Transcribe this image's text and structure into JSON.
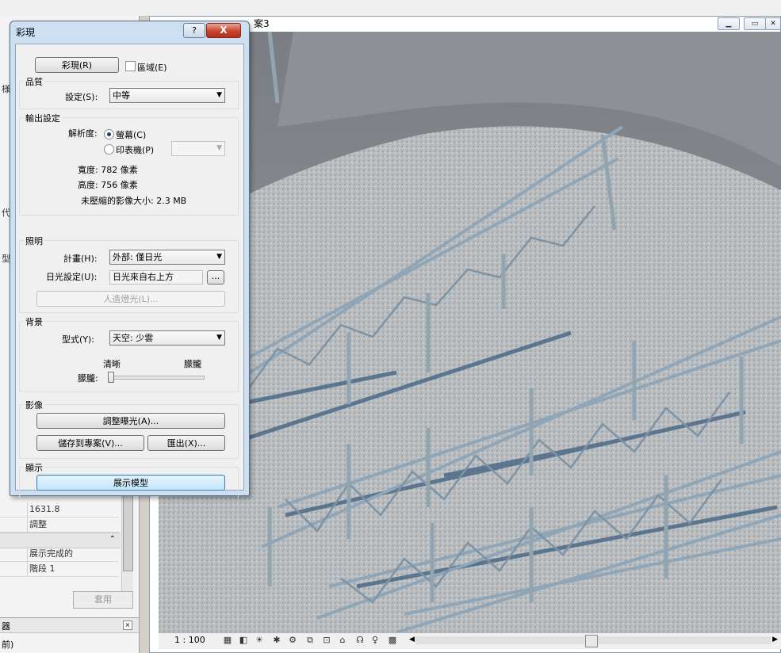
{
  "view": {
    "title_fragment": "案3",
    "scale": "1 : 100",
    "window_controls": [
      "min-icon",
      "restore-icon",
      "close-icon"
    ]
  },
  "left_panel": {
    "glyph_1": "様",
    "glyph_2": "代",
    "glyph_3": "型表",
    "props": [
      {
        "value": "1631.8"
      },
      {
        "value": "調整"
      },
      {
        "value": "展示完成的"
      },
      {
        "value": "階段 1"
      }
    ],
    "apply_label": "套用",
    "browser_title": "器",
    "browser_item": "前)"
  },
  "dialog": {
    "title": "彩現",
    "help_label": "?",
    "close_label": "X",
    "render_button": "彩現(R)",
    "region_label": "區域(E)",
    "region_checked": false,
    "quality": {
      "group_label": "品質",
      "setting_label": "設定(S):",
      "setting_value": "中等"
    },
    "output": {
      "group_label": "輸出設定",
      "resolution_label": "解析度:",
      "screen_label": "螢幕(C)",
      "printer_label": "印表機(P)",
      "selected": "screen",
      "printer_value": "",
      "width_text": "寬度:  782 像素",
      "height_text": "高度:  756 像素",
      "size_text": "未壓縮的影像大小: 2.3 MB"
    },
    "lighting": {
      "group_label": "照明",
      "scheme_label": "計畫(H):",
      "scheme_value": "外部: 僅日光",
      "sun_label": "日光設定(U):",
      "sun_value": "日光來自右上方",
      "sun_browse": "...",
      "artificial_label": "人造燈光(L)..."
    },
    "background": {
      "group_label": "背景",
      "style_label": "型式(Y):",
      "style_value": "天空: 少雲",
      "clear_label": "清晰",
      "haze_label": "朦朧",
      "haze_field_label": "朦朧:",
      "haze_level": 0.0
    },
    "image": {
      "group_label": "影像",
      "adjust_exposure": "調整曝光(A)...",
      "save_to_project": "儲存到專案(V)...",
      "export": "匯出(X)..."
    },
    "display": {
      "group_label": "顯示",
      "show_model": "展示模型"
    }
  }
}
